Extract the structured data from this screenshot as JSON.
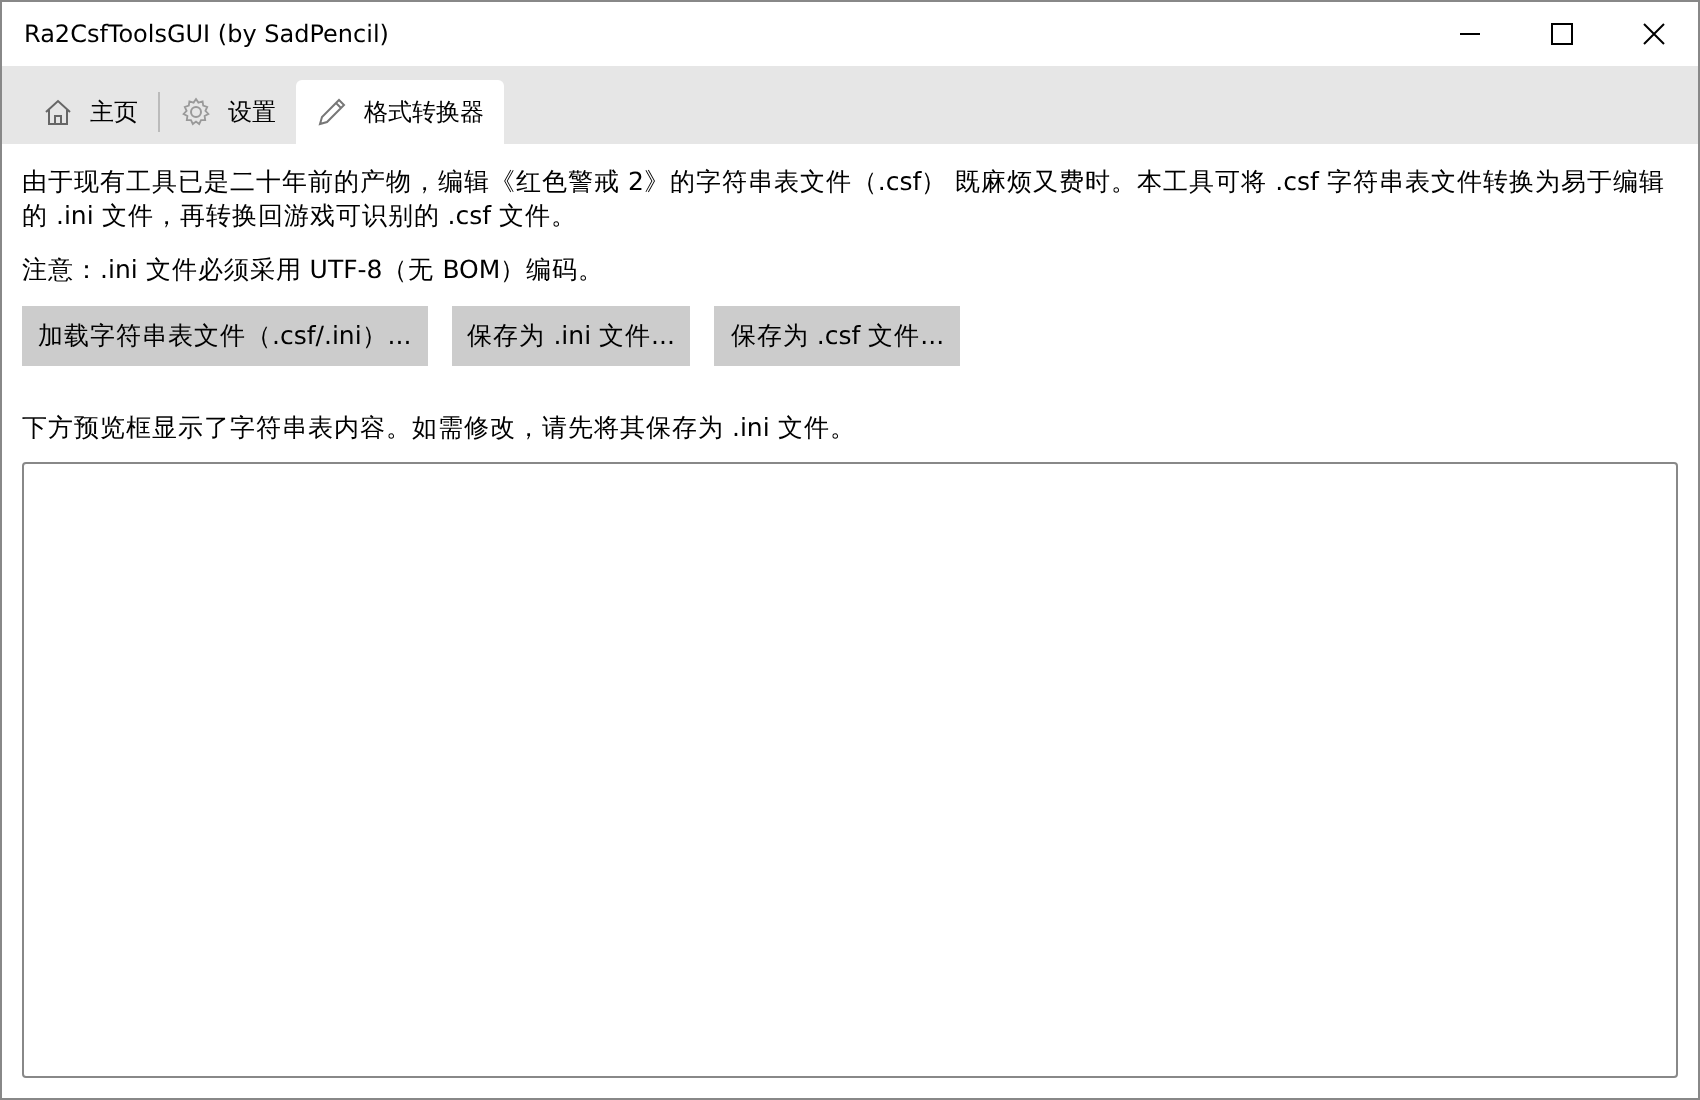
{
  "window": {
    "title": "Ra2CsfToolsGUI (by SadPencil)"
  },
  "tabs": [
    {
      "label": "主页",
      "kind": "home",
      "selected": false
    },
    {
      "label": "设置",
      "kind": "settings",
      "selected": false
    },
    {
      "label": "格式转换器",
      "kind": "converter",
      "selected": true
    }
  ],
  "description": "由于现有工具已是二十年前的产物，编辑《红色警戒 2》的字符串表文件（.csf） 既麻烦又费时。本工具可将 .csf 字符串表文件转换为易于编辑的 .ini 文件，再转换回游戏可识别的 .csf 文件。",
  "note": "注意：.ini 文件必须采用 UTF-8（无 BOM）编码。",
  "buttons": [
    "加载字符串表文件（.csf/.ini）...",
    "保存为 .ini 文件...",
    "保存为 .csf 文件..."
  ],
  "preview_hint": "下方预览框显示了字符串表内容。如需修改，请先将其保存为 .ini 文件。"
}
